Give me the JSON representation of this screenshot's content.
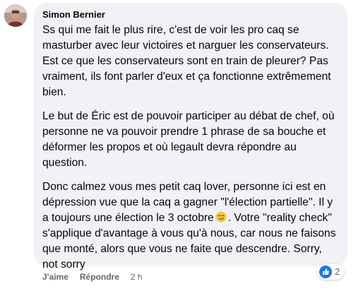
{
  "comment": {
    "author": "Simon Bernier",
    "paragraphs": [
      "Ss qui me fait le plus rire, c'est de voir les pro caq se masturber avec leur victoires et narguer les conservateurs. Est ce que les conservateurs sont en train de pleurer? Pas vraiment, ils font parler d'eux et ça fonctionne extrêmement bien.",
      "Le but de Éric est de pouvoir participer au débat de chef, où personne ne va pouvoir prendre 1 phrase de sa bouche et déformer les propos et où legault devra répondre au question."
    ],
    "paragraph3_part1": "Donc calmez vous mes petit caq lover, personne ici est en dépression vue que la caq a gagner \"l'élection partielle\". Il y a toujours une élection le 3 octobre",
    "paragraph3_emoji": "smirk-emoji",
    "paragraph3_part2": ". Votre \"reality check\" s'applique d'avantage à vous qu'à nous, car nous ne faisons que monté, alors que vous ne faite que descendre. Sorry, not sorry"
  },
  "actions": {
    "like_label": "J'aime",
    "reply_label": "Répondre",
    "timestamp": "2 h"
  },
  "reactions": {
    "icon": "like-icon",
    "count": "2"
  },
  "colors": {
    "bubble": "#f0f2f5",
    "text": "#050505",
    "secondary": "#65676b",
    "like_blue": "#1877f2"
  }
}
